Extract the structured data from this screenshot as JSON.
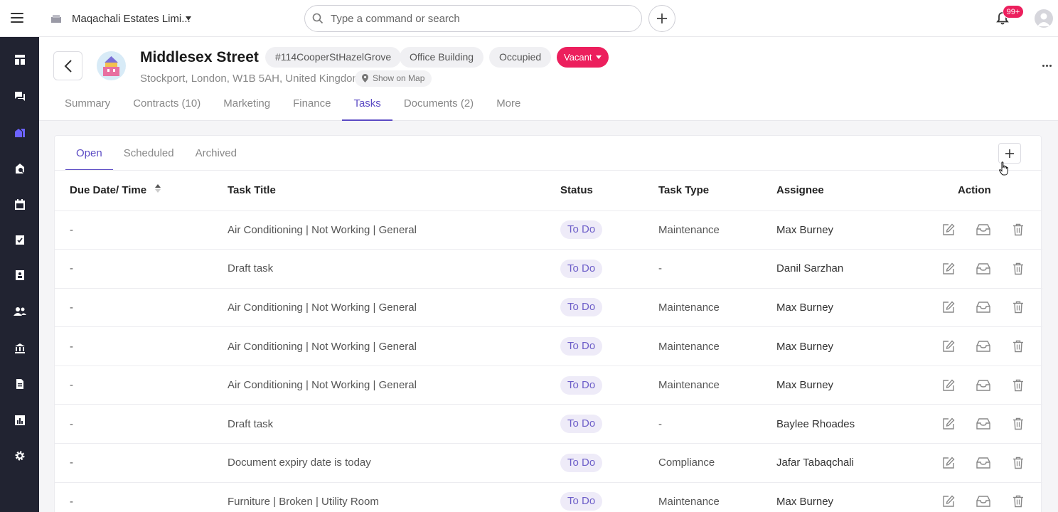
{
  "topbar": {
    "org_name": "Maqachali Estates Limi...",
    "search_placeholder": "Type a command or search",
    "notification_badge": "99+"
  },
  "sidebar": {
    "items": [
      "dashboard-icon",
      "chat-icon",
      "properties-icon",
      "tenancy-icon",
      "calendar-icon",
      "tasks-icon",
      "contacts-icon",
      "people-icon",
      "bank-icon",
      "document-icon",
      "reports-icon",
      "settings-icon"
    ],
    "active_index": 2,
    "active_color": "#6c63ff"
  },
  "property": {
    "title": "Middlesex Street",
    "ref": "#114CooperStHazelGrove",
    "type": "Office Building",
    "occupancy": "Occupied",
    "status": "Vacant",
    "address": "Stockport, London, W1B 5AH, United Kingdom",
    "map_link": "Show on Map"
  },
  "tabs": [
    "Summary",
    "Contracts (10)",
    "Marketing",
    "Finance",
    "Tasks",
    "Documents (2)",
    "More"
  ],
  "active_tab": "Tasks",
  "subtabs": [
    "Open",
    "Scheduled",
    "Archived"
  ],
  "table": {
    "headers": {
      "due": "Due Date/ Time",
      "title": "Task Title",
      "status": "Status",
      "type": "Task Type",
      "assignee": "Assignee",
      "action": "Action"
    },
    "rows": [
      {
        "due": "-",
        "title": "Air Conditioning | Not Working | General",
        "status": "To Do",
        "type": "Maintenance",
        "assignee": "Max Burney"
      },
      {
        "due": "-",
        "title": "Draft task",
        "status": "To Do",
        "type": "-",
        "assignee": "Danil Sarzhan"
      },
      {
        "due": "-",
        "title": "Air Conditioning | Not Working | General",
        "status": "To Do",
        "type": "Maintenance",
        "assignee": "Max Burney"
      },
      {
        "due": "-",
        "title": "Air Conditioning | Not Working | General",
        "status": "To Do",
        "type": "Maintenance",
        "assignee": "Max Burney"
      },
      {
        "due": "-",
        "title": "Air Conditioning | Not Working | General",
        "status": "To Do",
        "type": "Maintenance",
        "assignee": "Max Burney"
      },
      {
        "due": "-",
        "title": "Draft task",
        "status": "To Do",
        "type": "-",
        "assignee": "Baylee Rhoades"
      },
      {
        "due": "-",
        "title": "Document expiry date is today",
        "status": "To Do",
        "type": "Compliance",
        "assignee": "Jafar Tabaqchali"
      },
      {
        "due": "-",
        "title": "Furniture | Broken | Utility Room",
        "status": "To Do",
        "type": "Maintenance",
        "assignee": "Max Burney"
      }
    ]
  },
  "colors": {
    "accent": "#5b4bc4",
    "vacant": "#ec1f5d",
    "sidebar_bg": "#212331"
  }
}
